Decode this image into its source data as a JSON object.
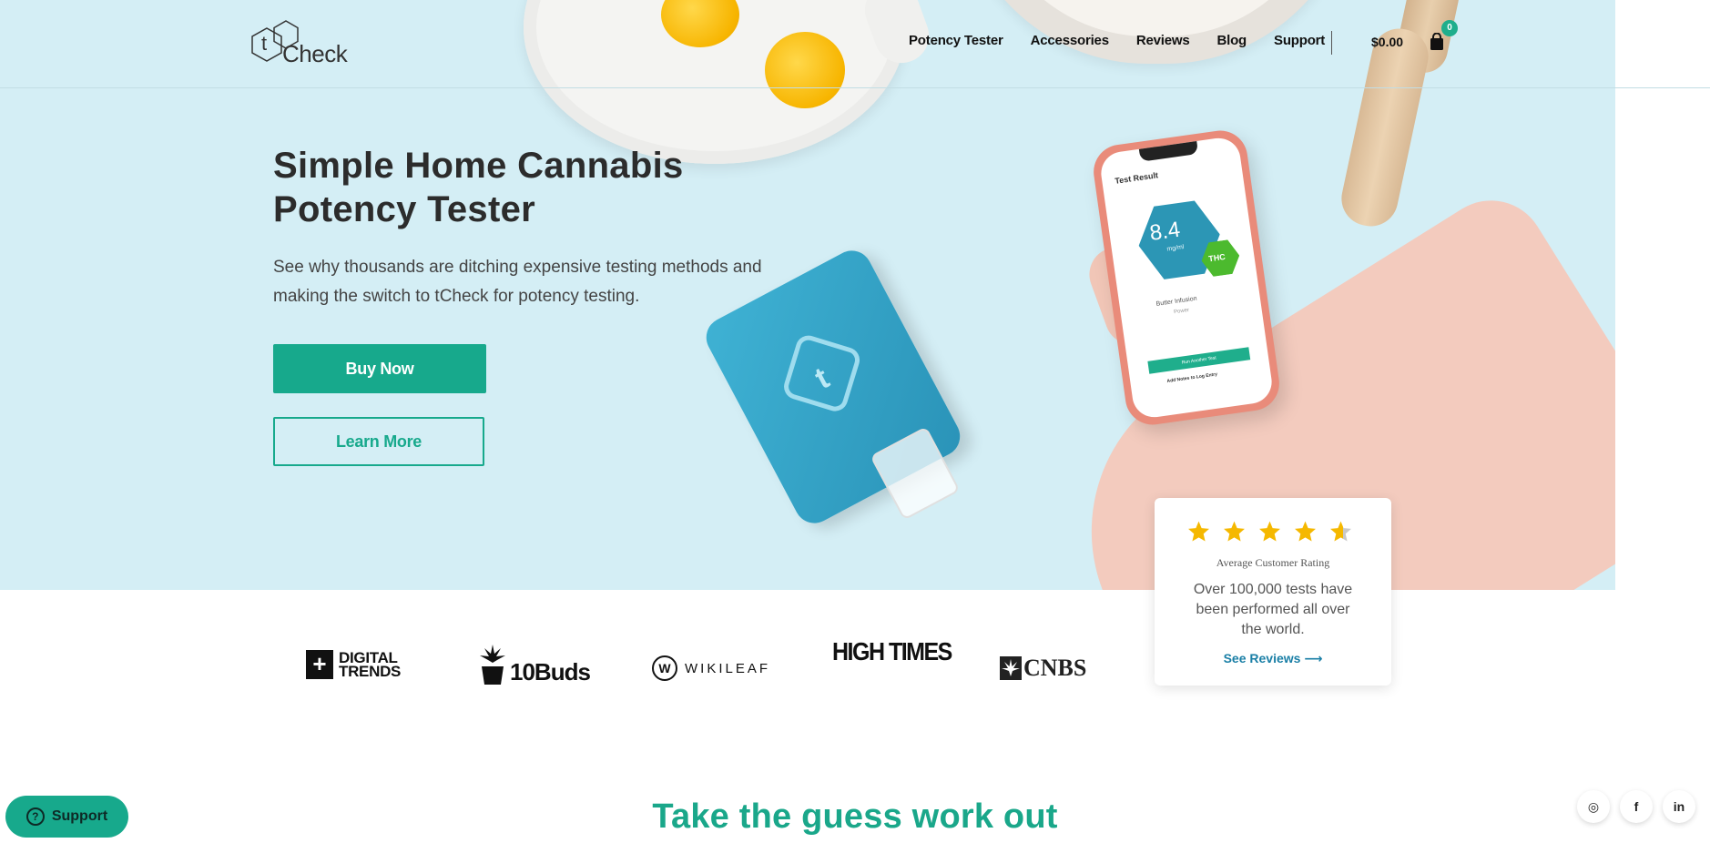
{
  "header": {
    "logo": {
      "letter": "t",
      "text": "Check"
    },
    "nav": [
      "Potency Tester",
      "Accessories",
      "Reviews",
      "Blog",
      "Support"
    ],
    "cart_total": "$0.00",
    "cart_count": "0"
  },
  "hero": {
    "title": "Simple Home Cannabis Potency Tester",
    "description": "See why thousands are ditching expensive testing methods and making the switch to tCheck for potency testing.",
    "buy_label": "Buy Now",
    "learn_label": "Learn More",
    "phone": {
      "title": "Test Result",
      "value": "8.4",
      "unit": "mg/ml",
      "badge": "THC",
      "subtitle": "Butter Infusion",
      "caption": "Power",
      "button": "Run Another Test",
      "link": "Add Notes to Log Entry"
    }
  },
  "rating": {
    "stars": 4.5,
    "label": "Average Customer Rating",
    "text": "Over 100,000 tests have been performed all over the world.",
    "link": "See Reviews ⟶"
  },
  "press": {
    "digital_trends": {
      "line1": "DIGITAL",
      "line2": "TRENDS"
    },
    "tenbuds": "10Buds",
    "wikileaf": {
      "mark": "W",
      "name": "WIKILEAF"
    },
    "hightimes": "HIGH TIMES",
    "cnbs": "CNBS"
  },
  "section": {
    "title": "Take the guess work out"
  },
  "support": {
    "label": "Support"
  },
  "social": {
    "instagram": "◎",
    "facebook": "f",
    "linkedin": "in"
  },
  "colors": {
    "brand": "#17a98c",
    "hero_bg": "#d4eef5",
    "star": "#f5b800",
    "link": "#1a7fa6"
  }
}
